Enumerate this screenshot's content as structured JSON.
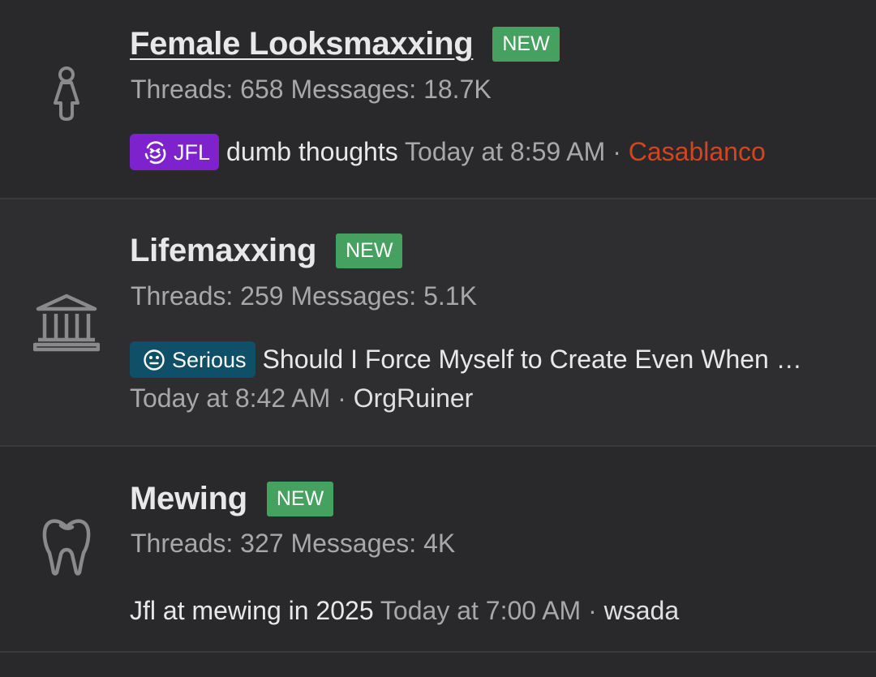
{
  "nodes": [
    {
      "title": "Female Looksmaxxing",
      "new_badge": "NEW",
      "threads_label": "Threads:",
      "threads_value": "658",
      "messages_label": "Messages:",
      "messages_value": "18.7K",
      "icon": "female-icon",
      "latest": {
        "prefix_label": "JFL",
        "prefix_color": "#7e22ce",
        "title": "dumb thoughts",
        "time": "Today at 8:59 AM",
        "separator": "·",
        "user": "Casablanco",
        "user_color": "#d4441f"
      }
    },
    {
      "title": "Lifemaxxing",
      "new_badge": "NEW",
      "threads_label": "Threads:",
      "threads_value": "259",
      "messages_label": "Messages:",
      "messages_value": "5.1K",
      "icon": "bank-icon",
      "latest": {
        "prefix_label": "Serious",
        "prefix_color": "#0f5068",
        "title": "Should I Force Myself to Create Even When …",
        "time": "Today at 8:42 AM",
        "separator": "·",
        "user": "OrgRuiner"
      }
    },
    {
      "title": "Mewing",
      "new_badge": "NEW",
      "threads_label": "Threads:",
      "threads_value": "327",
      "messages_label": "Messages:",
      "messages_value": "4K",
      "icon": "tooth-icon",
      "latest": {
        "title": "Jfl at mewing in 2025",
        "time": "Today at 7:00 AM",
        "separator": "·",
        "user": "wsada"
      }
    }
  ],
  "colors": {
    "badge_new": "#46a160",
    "background": "#29292c",
    "muted_text": "#a8a8ab"
  }
}
